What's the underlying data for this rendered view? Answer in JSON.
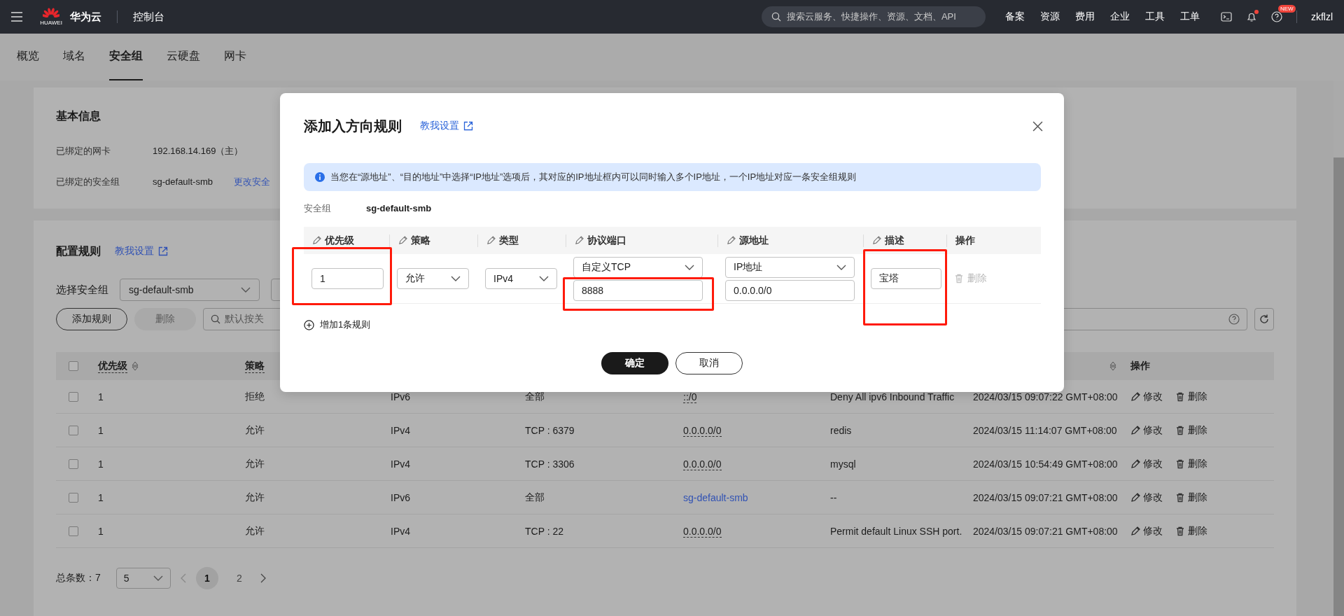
{
  "topbar": {
    "logo_caption": "HUAWEI",
    "brand": "华为云",
    "console": "控制台",
    "search_placeholder": "搜索云服务、快捷操作、资源、文档、API",
    "nav": [
      "备案",
      "资源",
      "费用",
      "企业",
      "工具",
      "工单"
    ],
    "notification_dot": true,
    "help_badge": "NEW",
    "user": "zkflzl"
  },
  "tabs": [
    {
      "label": "概览",
      "selected": false
    },
    {
      "label": "域名",
      "selected": false
    },
    {
      "label": "安全组",
      "selected": true
    },
    {
      "label": "云硬盘",
      "selected": false
    },
    {
      "label": "网卡",
      "selected": false
    }
  ],
  "basic_info": {
    "title": "基本信息",
    "rows": [
      {
        "label": "已绑定的网卡",
        "value": "192.168.14.169（主）"
      },
      {
        "label": "已绑定的安全组",
        "value": "sg-default-smb",
        "link": "更改安全"
      }
    ]
  },
  "rules": {
    "title": "配置规则",
    "help_link": "教我设置",
    "select_label": "选择安全组",
    "select_value": "sg-default-smb",
    "add_button": "添加规则",
    "delete_button": {
      "label": "删除",
      "disabled": true
    },
    "search_placeholder": "默认按关",
    "header": {
      "checked": false,
      "priority": {
        "label": "优先级",
        "sortable": true
      },
      "policy": {
        "label": "策略"
      },
      "time": {
        "sortable": true
      },
      "actions": {
        "label": "操作"
      }
    },
    "rows": [
      {
        "priority": "1",
        "policy": "拒绝",
        "type": "IPv6",
        "protocol": "全部",
        "checked": false,
        "source": {
          "text": "::/0",
          "kind": "ip"
        },
        "description": "Deny All ipv6 Inbound Traffic",
        "time": "2024/03/15 09:07:22 GMT+08:00",
        "edit": "修改",
        "delete": "删除"
      },
      {
        "priority": "1",
        "policy": "允许",
        "type": "IPv4",
        "protocol": "TCP : 6379",
        "checked": false,
        "source": {
          "text": "0.0.0.0/0",
          "kind": "ip"
        },
        "description": "redis",
        "time": "2024/03/15 11:14:07 GMT+08:00",
        "edit": "修改",
        "delete": "删除"
      },
      {
        "priority": "1",
        "policy": "允许",
        "type": "IPv4",
        "protocol": "TCP : 3306",
        "checked": false,
        "source": {
          "text": "0.0.0.0/0",
          "kind": "ip"
        },
        "description": "mysql",
        "time": "2024/03/15 10:54:49 GMT+08:00",
        "edit": "修改",
        "delete": "删除"
      },
      {
        "priority": "1",
        "policy": "允许",
        "type": "IPv6",
        "protocol": "全部",
        "checked": false,
        "source": {
          "text": "sg-default-smb",
          "kind": "group"
        },
        "description": "--",
        "time": "2024/03/15 09:07:21 GMT+08:00",
        "edit": "修改",
        "delete": "删除"
      },
      {
        "priority": "1",
        "policy": "允许",
        "type": "IPv4",
        "protocol": "TCP : 22",
        "checked": false,
        "source": {
          "text": "0.0.0.0/0",
          "kind": "ip"
        },
        "description": "Permit default Linux SSH port.",
        "time": "2024/03/15 09:07:21 GMT+08:00",
        "edit": "修改",
        "delete": "删除"
      }
    ],
    "total": "总条数：7",
    "page_size": "5",
    "pages": [
      {
        "label": "1",
        "selected": true
      },
      {
        "label": "2",
        "selected": false
      }
    ]
  },
  "dialog": {
    "title": "添加入方向规则",
    "help_link": "教我设置",
    "notice": "当您在“源地址”、“目的地址”中选择“IP地址”选项后，其对应的IP地址框内可以同时输入多个IP地址，一个IP地址对应一条安全组规则",
    "group_label": "安全组",
    "group_value": "sg-default-smb",
    "columns": [
      {
        "label": "优先级",
        "editable": true
      },
      {
        "label": "策略",
        "editable": true
      },
      {
        "label": "类型",
        "editable": true
      },
      {
        "label": "协议端口",
        "editable": true
      },
      {
        "label": "源地址",
        "editable": true
      },
      {
        "label": "描述",
        "editable": true
      },
      {
        "label": "操作",
        "editable": false
      }
    ],
    "rule": {
      "priority": "1",
      "policy": "允许",
      "type": "IPv4",
      "protocol": "自定义TCP",
      "port": "8888",
      "source_type": "IP地址",
      "source": "0.0.0.0/0",
      "description": "宝塔",
      "delete": {
        "label": "删除",
        "disabled": true
      }
    },
    "highlighted": {
      "priority": true,
      "protocol": true,
      "description": true
    },
    "add_rule": "增加1条规则",
    "ok": "确定",
    "cancel": "取消"
  }
}
